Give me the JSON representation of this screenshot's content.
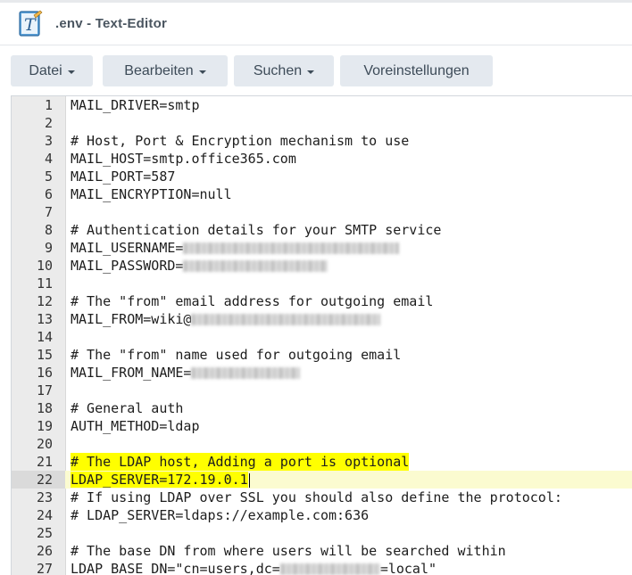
{
  "window": {
    "title": ".env - Text-Editor",
    "icon": "text-editor-app-icon"
  },
  "toolbar": {
    "datei": "Datei",
    "bearbeiten": "Bearbeiten",
    "suchen": "Suchen",
    "voreinstellungen": "Voreinstellungen"
  },
  "editor": {
    "active_line": 22,
    "highlight_color": "#ffff00",
    "lines": [
      {
        "n": "1",
        "text": "MAIL_DRIVER=smtp"
      },
      {
        "n": "2",
        "text": ""
      },
      {
        "n": "3",
        "text": "# Host, Port & Encryption mechanism to use"
      },
      {
        "n": "4",
        "text": "MAIL_HOST=smtp.office365.com"
      },
      {
        "n": "5",
        "text": "MAIL_PORT=587"
      },
      {
        "n": "6",
        "text": "MAIL_ENCRYPTION=null"
      },
      {
        "n": "7",
        "text": ""
      },
      {
        "n": "8",
        "text": "# Authentication details for your SMTP service"
      },
      {
        "n": "9",
        "text": "MAIL_USERNAME="
      },
      {
        "n": "10",
        "text": "MAIL_PASSWORD="
      },
      {
        "n": "11",
        "text": ""
      },
      {
        "n": "12",
        "text": "# The \"from\" email address for outgoing email"
      },
      {
        "n": "13",
        "text": "MAIL_FROM=wiki@"
      },
      {
        "n": "14",
        "text": ""
      },
      {
        "n": "15",
        "text": "# The \"from\" name used for outgoing email"
      },
      {
        "n": "16",
        "text": "MAIL_FROM_NAME="
      },
      {
        "n": "17",
        "text": ""
      },
      {
        "n": "18",
        "text": "# General auth"
      },
      {
        "n": "19",
        "text": "AUTH_METHOD=ldap"
      },
      {
        "n": "20",
        "text": ""
      },
      {
        "n": "21",
        "text": "# The LDAP host, Adding a port is optional"
      },
      {
        "n": "22",
        "text": "LDAP_SERVER=172.19.0.1"
      },
      {
        "n": "23",
        "text": "# If using LDAP over SSL you should also define the protocol:"
      },
      {
        "n": "24",
        "text": "# LDAP_SERVER=ldaps://example.com:636"
      },
      {
        "n": "25",
        "text": ""
      },
      {
        "n": "26",
        "text": "# The base DN from where users will be searched within"
      },
      {
        "n": "27",
        "text": "LDAP_BASE_DN=\"cn=users,dc="
      },
      {
        "n": "27b",
        "text": "=local\""
      }
    ]
  }
}
